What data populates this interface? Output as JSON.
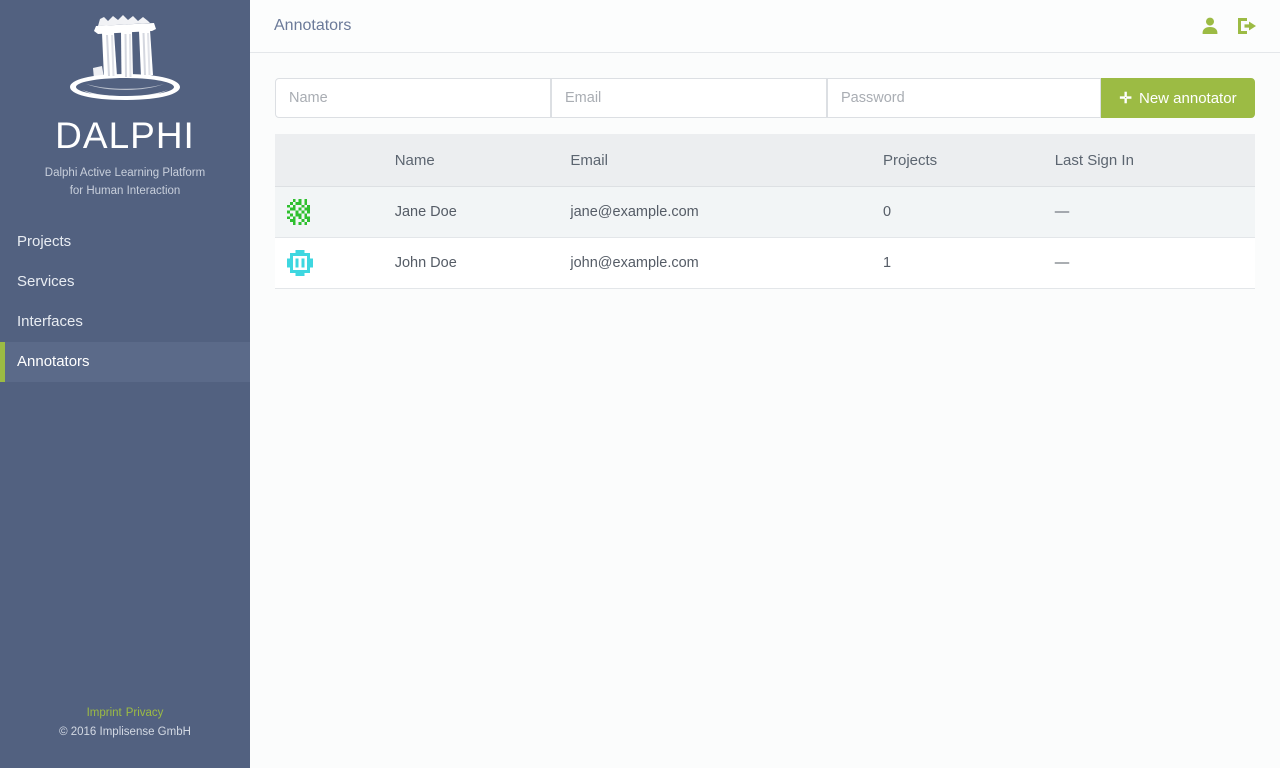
{
  "sidebar": {
    "logo_icon": "greek-temple-ruin-logo",
    "brand_title": "DALPHI",
    "brand_subtitle_line1": "Dalphi Active Learning Platform",
    "brand_subtitle_line2": "for Human Interaction",
    "items": [
      {
        "label": "Projects",
        "active": false
      },
      {
        "label": "Services",
        "active": false
      },
      {
        "label": "Interfaces",
        "active": false
      },
      {
        "label": "Annotators",
        "active": true
      }
    ],
    "footer": {
      "imprint_label": "Imprint",
      "privacy_label": "Privacy",
      "copyright": "© 2016 Implisense GmbH"
    }
  },
  "header": {
    "title": "Annotators",
    "user_icon": "user-icon",
    "signout_icon": "sign-out-icon"
  },
  "form": {
    "name_placeholder": "Name",
    "name_value": "",
    "email_placeholder": "Email",
    "email_value": "",
    "password_placeholder": "Password",
    "password_value": "",
    "new_button_label": "New annotator",
    "plus_icon": "plus-icon"
  },
  "table": {
    "columns": [
      "",
      "Name",
      "Email",
      "Projects",
      "Last Sign In"
    ],
    "rows": [
      {
        "avatar_icon": "identicon-avatar",
        "avatar_color": "#2fc02f",
        "name": "Jane Doe",
        "email": "jane@example.com",
        "projects": "0",
        "last_sign_in": "—"
      },
      {
        "avatar_icon": "identicon-avatar",
        "avatar_color": "#3ed7e0",
        "name": "John Doe",
        "email": "john@example.com",
        "projects": "1",
        "last_sign_in": "—"
      }
    ]
  },
  "colors": {
    "sidebar_bg": "#526180",
    "sidebar_active_bg": "#5b6a89",
    "accent_green": "#9cbb44",
    "page_bg": "#fbfcfc",
    "table_header_bg": "#eceef0"
  }
}
